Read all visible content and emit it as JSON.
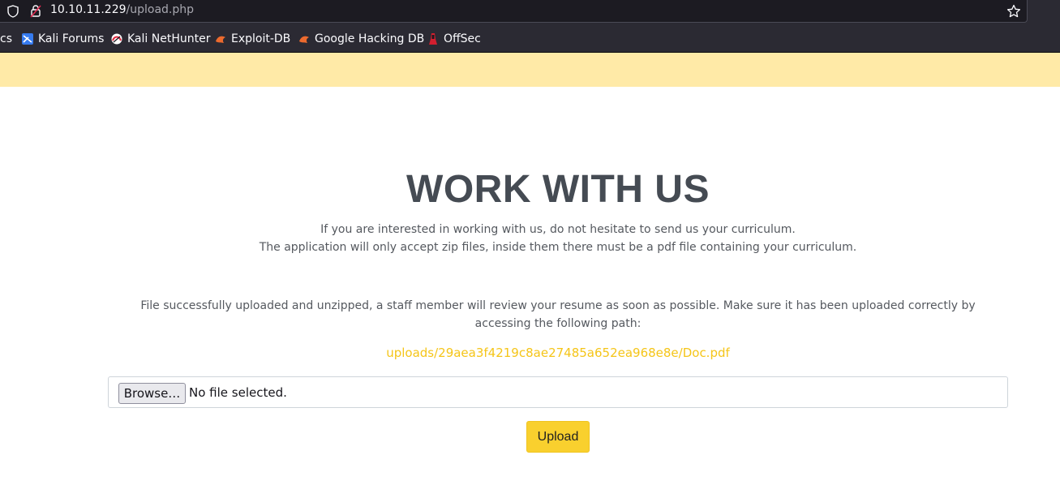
{
  "browser": {
    "url_host": "10.10.11.229",
    "url_path": "/upload.php"
  },
  "bookmarks": [
    {
      "label": "cs",
      "icon": "kali-docs-icon"
    },
    {
      "label": "Kali Forums",
      "icon": "kali-forums-icon"
    },
    {
      "label": "Kali NetHunter",
      "icon": "kali-nethunter-icon"
    },
    {
      "label": "Exploit-DB",
      "icon": "exploit-db-icon"
    },
    {
      "label": "Google Hacking DB",
      "icon": "ghdb-icon"
    },
    {
      "label": "OffSec",
      "icon": "offsec-icon"
    }
  ],
  "page": {
    "title": "WORK WITH US",
    "intro_line1": "If you are interested in working with us, do not hesitate to send us your curriculum.",
    "intro_line2": "The application will only accept zip files, inside them there must be a pdf file containing your curriculum.",
    "success_message": "File successfully uploaded and unzipped, a staff member will review your resume as soon as possible. Make sure it has been uploaded correctly by accessing the following path:",
    "file_path": "uploads/29aea3f4219c8ae27485a652ea968e8e/Doc.pdf",
    "browse_label": "Browse…",
    "no_file_label": "No file selected.",
    "upload_label": "Upload"
  },
  "colors": {
    "notice_bar": "#ffeaa7",
    "accent": "#f9d02e",
    "link": "#f5c518",
    "title": "#454b53"
  }
}
